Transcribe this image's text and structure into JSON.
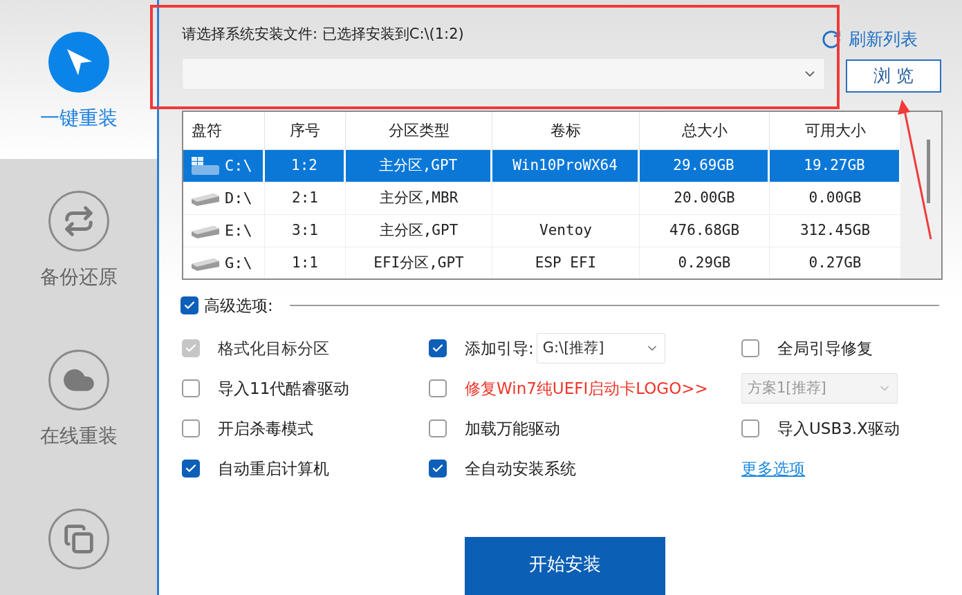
{
  "sidebar": {
    "items": [
      {
        "label": "一键重装",
        "selected": true,
        "kind": "cursor"
      },
      {
        "label": "备份还原",
        "selected": false,
        "kind": "sync"
      },
      {
        "label": "在线重装",
        "selected": false,
        "kind": "cloud"
      },
      {
        "selected": false,
        "kind": "copy"
      }
    ]
  },
  "install_file": {
    "label": "请选择系统安装文件: 已选择安装到C:\\(1:2)",
    "refresh_link": "刷新列表",
    "browse_button": "浏 览"
  },
  "table": {
    "columns": [
      "盘符",
      "序号",
      "分区类型",
      "卷标",
      "总大小",
      "可用大小"
    ],
    "rows": [
      {
        "drive": "C:\\",
        "number": "1:2",
        "partition_type": "主分区,GPT",
        "volume_label": "Win10ProWX64",
        "total": "29.69GB",
        "free": "19.27GB",
        "selected": true,
        "kind": "windows"
      },
      {
        "drive": "D:\\",
        "number": "2:1",
        "partition_type": "主分区,MBR",
        "total": "20.00GB",
        "free": "0.00GB",
        "selected": false,
        "kind": "disk"
      },
      {
        "drive": "E:\\",
        "number": "3:1",
        "partition_type": "主分区,GPT",
        "volume_label": "Ventoy",
        "total": "476.68GB",
        "free": "312.45GB",
        "selected": false,
        "kind": "disk"
      },
      {
        "drive": "G:\\",
        "number": "1:1",
        "partition_type": "EFI分区,GPT",
        "volume_label": "ESP EFI",
        "total": "0.29GB",
        "free": "0.27GB",
        "selected": false,
        "kind": "disk"
      }
    ]
  },
  "advanced": {
    "label": "高级选项:",
    "checked": true,
    "options": [
      {
        "kind": "checkbox",
        "label": "格式化目标分区",
        "checked": true,
        "disabled": true
      },
      {
        "kind": "checkbox",
        "label": "添加引导:",
        "checked": true,
        "select": "G:\\[推荐]"
      },
      {
        "kind": "checkbox",
        "label": "全局引导修复",
        "checked": false
      },
      {
        "kind": "checkbox",
        "label": "导入11代酷睿驱动",
        "checked": false
      },
      {
        "kind": "checkbox",
        "label": "修复Win7纯UEFI启动卡LOGO>>",
        "checked": false,
        "color": "#f0352a"
      },
      {
        "kind": "select",
        "value": "方案1[推荐]",
        "disabled": true
      },
      {
        "kind": "checkbox",
        "label": "开启杀毒模式",
        "checked": false
      },
      {
        "kind": "checkbox",
        "label": "加载万能驱动",
        "checked": false
      },
      {
        "kind": "checkbox",
        "label": "导入USB3.X驱动",
        "checked": false
      },
      {
        "kind": "checkbox",
        "label": "自动重启计算机",
        "checked": true
      },
      {
        "kind": "checkbox",
        "label": "全自动安装系统",
        "checked": true
      },
      {
        "kind": "link",
        "label": "更多选项"
      }
    ]
  },
  "start_button": "开始安装"
}
